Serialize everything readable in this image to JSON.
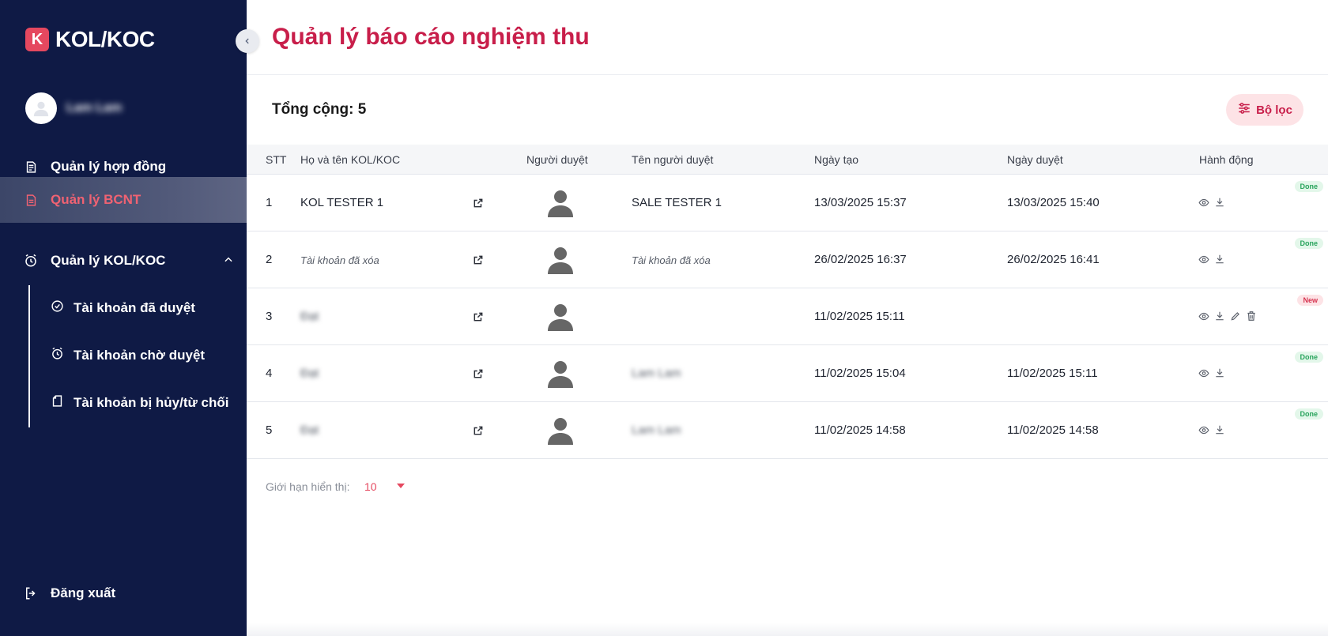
{
  "app": {
    "logo_letter": "K",
    "logo_text": "KOL/KOC",
    "collapse_icon": "chevron-left-icon"
  },
  "user": {
    "name": "Lam Lam"
  },
  "sidebar": {
    "items": [
      {
        "label": "Quản lý hợp đồng",
        "icon": "document-icon"
      },
      {
        "label": "Quản lý BCNT",
        "icon": "report-icon",
        "active": true
      },
      {
        "label": "Quản lý KOL/KOC",
        "icon": "alarm-clock-icon",
        "expanded": true
      }
    ],
    "sub_items": [
      {
        "label": "Tài khoản đã duyệt",
        "icon": "check-circle-icon"
      },
      {
        "label": "Tài khoản chờ duyệt",
        "icon": "alarm-clock-icon"
      },
      {
        "label": "Tài khoản bị hủy/từ chối",
        "icon": "file-icon"
      }
    ],
    "logout_label": "Đăng xuất"
  },
  "page": {
    "title": "Quản lý báo cáo nghiệm thu",
    "total_text": "Tổng cộng: 5",
    "filter_label": "Bộ lọc"
  },
  "table": {
    "headers": [
      "STT",
      "Họ và tên KOL/KOC",
      "Người duyệt",
      "Tên người duyệt",
      "Ngày tạo",
      "Ngày duyệt",
      "Hành động"
    ],
    "rows": [
      {
        "stt": "1",
        "name": "KOL TESTER 1",
        "approver_name": "SALE TESTER 1",
        "created": "13/03/2025 15:37",
        "approved": "13/03/2025 15:40",
        "status": "Done"
      },
      {
        "stt": "2",
        "name": "Tài khoản đã xóa",
        "approver_name": "Tài khoản đã xóa",
        "created": "26/02/2025 16:37",
        "approved": "26/02/2025 16:41",
        "status": "Done"
      },
      {
        "stt": "3",
        "name": "Đạt",
        "approver_name": "",
        "created": "11/02/2025 15:11",
        "approved": "",
        "status": "New"
      },
      {
        "stt": "4",
        "name": "Đạt",
        "approver_name": "Lam Lam",
        "created": "11/02/2025 15:04",
        "approved": "11/02/2025 15:11",
        "status": "Done"
      },
      {
        "stt": "5",
        "name": "Đạt",
        "approver_name": "Lam Lam",
        "created": "11/02/2025 14:58",
        "approved": "11/02/2025 14:58",
        "status": "Done"
      }
    ]
  },
  "pagination": {
    "limit_label": "Giới hạn hiển thị:",
    "limit_value": "10"
  },
  "colors": {
    "sidebar_bg": "#0f1a45",
    "accent": "#c81e4a",
    "done": "#27a35b",
    "new": "#d6334f"
  }
}
